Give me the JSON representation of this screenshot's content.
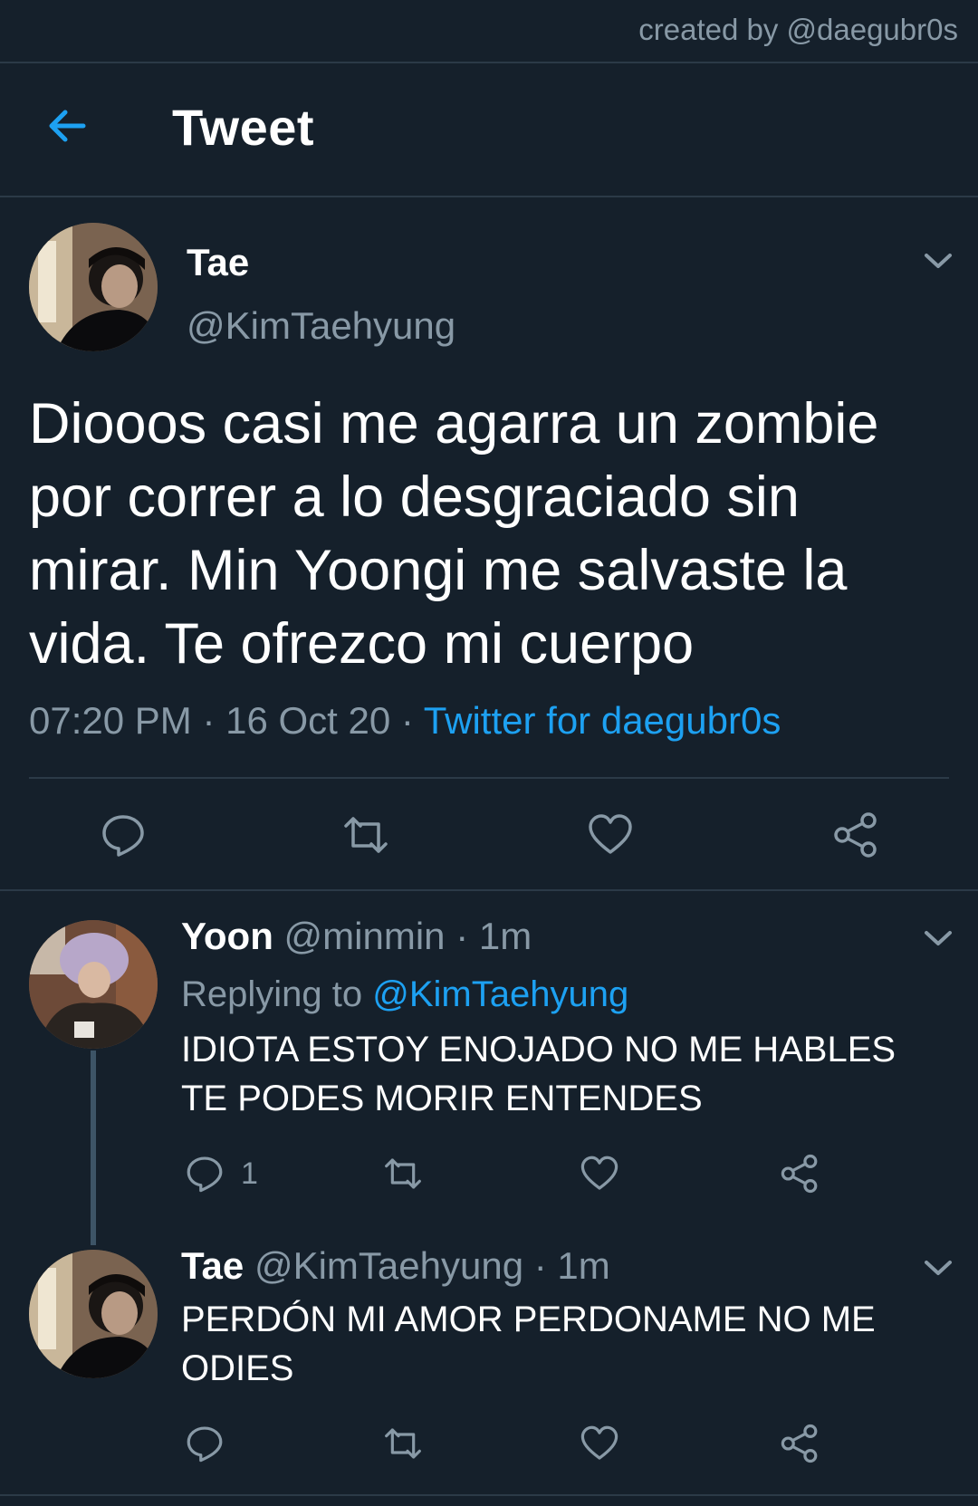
{
  "credit": "created by @daegubr0s",
  "header": {
    "title": "Tweet"
  },
  "tweet": {
    "name": "Tae",
    "handle": "@KimTaehyung",
    "text": "Diooos casi me agarra un zombie por correr a lo desgraciado sin mirar. Min Yoongi me salvaste la vida. Te ofrezco mi cuerpo",
    "time": "07:20 PM",
    "sep1": " · ",
    "date": "16 Oct 20",
    "sep2": " · ",
    "source": "Twitter for daegubr0s"
  },
  "replies": [
    {
      "name": "Yoon",
      "handle": "@minmin",
      "sep": " · ",
      "age": "1m",
      "replying_label": "Replying to",
      "replying_handle": "@KimTaehyung",
      "text": "IDIOTA ESTOY ENOJADO NO ME HABLES TE PODES MORIR ENTENDES",
      "reply_count": "1"
    },
    {
      "name": "Tae",
      "handle": "@KimTaehyung",
      "sep": " · ",
      "age": "1m",
      "text": "PERDÓN MI AMOR PERDONAME NO ME ODIES"
    }
  ],
  "colors": {
    "background": "#15202b",
    "accent": "#1da1f2",
    "muted": "#8899a6",
    "divider": "#2b3a47"
  },
  "icons": [
    "back-arrow-icon",
    "chevron-down-icon",
    "reply-icon",
    "retweet-icon",
    "like-icon",
    "share-icon"
  ]
}
